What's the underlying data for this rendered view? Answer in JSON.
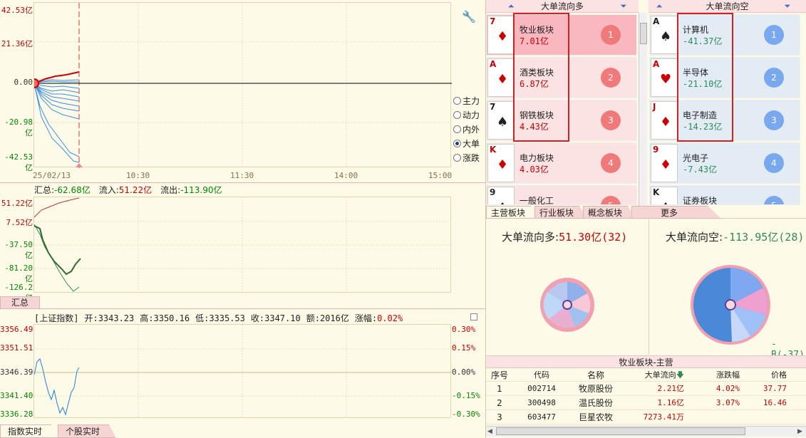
{
  "main_chart": {
    "y_labels": [
      "42.53亿",
      "21.36亿",
      "0.00",
      "-20.98亿",
      "-42.53亿"
    ],
    "x_labels": [
      "25/02/13",
      "10:30",
      "11:30",
      "14:00",
      "15:00"
    ],
    "radio_options": [
      {
        "label": "主力",
        "checked": false
      },
      {
        "label": "动力",
        "checked": false
      },
      {
        "label": "内外",
        "checked": false
      },
      {
        "label": "大单",
        "checked": true
      },
      {
        "label": "涨跌",
        "checked": false
      }
    ]
  },
  "flow_chart": {
    "summary_label": "汇总:",
    "summary_value": "-62.68亿",
    "inflow_label": "流入:",
    "inflow_value": "51.22亿",
    "outflow_label": "流出:",
    "outflow_value": "-113.90亿",
    "y_labels": [
      "51.22亿",
      "7.52亿",
      "-37.50亿",
      "-81.20亿",
      "-126.2亿"
    ],
    "tab_label": "汇总"
  },
  "index_chart": {
    "name": "[上证指数]",
    "open_label": "开:",
    "open": "3343.23",
    "high_label": "高:",
    "high": "3350.16",
    "low_label": "低:",
    "low": "3335.53",
    "close_label": "收:",
    "close": "3347.10",
    "amount_label": "额:",
    "amount": "2016亿",
    "change_label": "涨幅:",
    "change": "0.02%",
    "y_labels": [
      "3356.49",
      "3351.51",
      "3346.39",
      "3341.40",
      "3336.28"
    ],
    "pct_labels": [
      "0.30%",
      "0.15%",
      "0.00%",
      "-0.15%",
      "-0.30%"
    ]
  },
  "bottom_tabs": [
    {
      "label": "指数实时",
      "active": true
    },
    {
      "label": "个股实时",
      "active": false
    }
  ],
  "long_column": {
    "title": "大单流向多",
    "items": [
      {
        "rank_card": "7",
        "suit": "♦",
        "name": "牧业板块",
        "value": "7.01亿",
        "num": "1"
      },
      {
        "rank_card": "A",
        "suit": "♦",
        "name": "酒类板块",
        "value": "6.87亿",
        "num": "2"
      },
      {
        "rank_card": "7",
        "suit": "♠",
        "name": "钢铁板块",
        "value": "4.43亿",
        "num": "3"
      },
      {
        "rank_card": "K",
        "suit": "♦",
        "name": "电力板块",
        "value": "4.03亿",
        "num": "4"
      },
      {
        "rank_card": "9",
        "suit": "♠",
        "name": "一般化工",
        "value": "",
        "num": "5"
      }
    ]
  },
  "short_column": {
    "title": "大单流向空",
    "items": [
      {
        "rank_card": "A",
        "suit": "♠",
        "name": "计算机",
        "value": "-41.37亿",
        "num": "1"
      },
      {
        "rank_card": "A",
        "suit": "♥",
        "name": "半导体",
        "value": "-21.10亿",
        "num": "2"
      },
      {
        "rank_card": "J",
        "suit": "♦",
        "name": "电子制造",
        "value": "-14.23亿",
        "num": "3"
      },
      {
        "rank_card": "9",
        "suit": "♦",
        "name": "光电子",
        "value": "-7.43亿",
        "num": "4"
      },
      {
        "rank_card": "K",
        "suit": "♠",
        "name": "证券板块",
        "value": "",
        "num": "5"
      }
    ]
  },
  "category_tabs": [
    {
      "label": "主营板块",
      "active": true
    },
    {
      "label": "行业板块",
      "active": false
    },
    {
      "label": "概念板块",
      "active": false
    },
    {
      "label": "更多",
      "active": false
    }
  ],
  "stats": {
    "long_label": "大单流向多:",
    "long_value": "51.30亿(32)",
    "short_label": "大单流向空:",
    "short_value": "-113.95亿(28)",
    "short_extra": "-B(-37)"
  },
  "table": {
    "title": "牧业板块-主营",
    "headers": [
      "序号",
      "代码",
      "名称",
      "大单流向",
      "涨跌幅",
      "价格"
    ],
    "rows": [
      [
        "1",
        "002714",
        "牧原股份",
        "2.21亿",
        "4.02%",
        "37.77"
      ],
      [
        "2",
        "300498",
        "温氏股份",
        "1.16亿",
        "3.07%",
        "16.46"
      ],
      [
        "3",
        "603477",
        "巨星农牧",
        "7273.41万",
        "",
        ""
      ]
    ]
  },
  "colors": {
    "long_card_bg": "#fbe3e3",
    "long_card_highlight": "#f9b8c0",
    "short_card_bg": "#e3ebf5",
    "long_badge": "#f07a7a",
    "short_badge": "#7aa8ee",
    "highlight_box": "#d32020"
  }
}
